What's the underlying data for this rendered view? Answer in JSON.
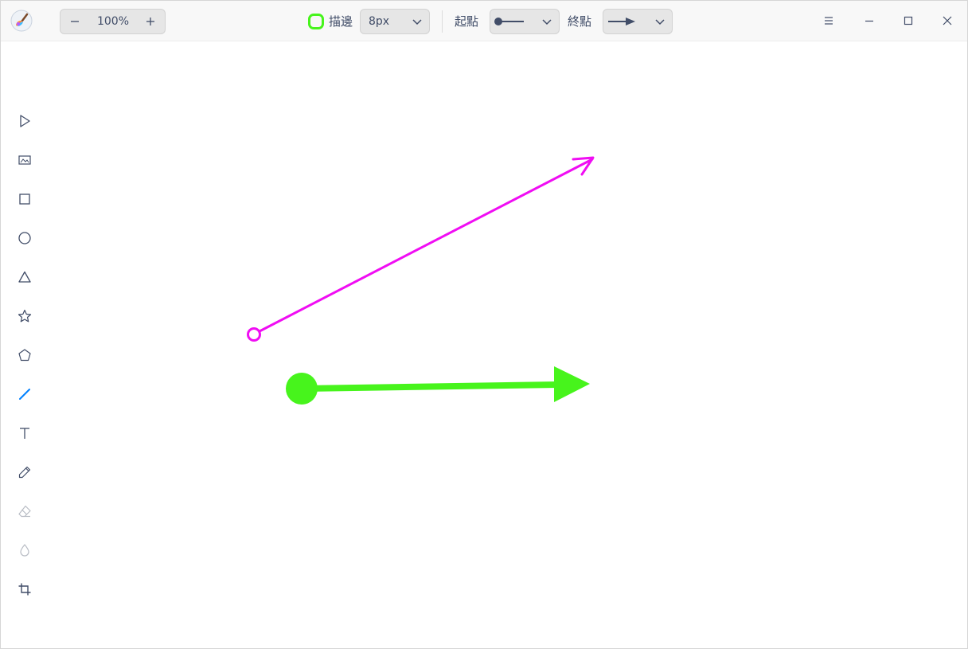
{
  "header": {
    "zoom": {
      "value": "100%"
    },
    "stroke_label": "描邊",
    "stroke_color": "#47f41c",
    "stroke_width": "8px",
    "start_label": "起點",
    "end_label": "終點",
    "start_style": "circle-filled",
    "end_style": "arrow-filled"
  },
  "window_controls": [
    "menu-icon",
    "minimize-icon",
    "maximize-icon",
    "close-icon"
  ],
  "tools": [
    {
      "name": "select",
      "icon": "select-arrow-icon"
    },
    {
      "name": "image",
      "icon": "image-icon"
    },
    {
      "name": "rectangle",
      "icon": "rectangle-icon"
    },
    {
      "name": "ellipse",
      "icon": "ellipse-icon"
    },
    {
      "name": "triangle",
      "icon": "triangle-icon"
    },
    {
      "name": "star",
      "icon": "star-icon"
    },
    {
      "name": "polygon",
      "icon": "polygon-icon"
    },
    {
      "name": "line",
      "icon": "line-icon",
      "active": true
    },
    {
      "name": "text",
      "icon": "text-icon"
    },
    {
      "name": "pencil",
      "icon": "pencil-icon"
    },
    {
      "name": "eraser",
      "icon": "eraser-icon",
      "disabled": true
    },
    {
      "name": "blur",
      "icon": "blur-drop-icon",
      "disabled": true
    },
    {
      "name": "crop",
      "icon": "crop-icon"
    }
  ],
  "canvas": {
    "shapes": [
      {
        "type": "line",
        "color": "#f00df3",
        "start_cap": "circle-hollow",
        "end_cap": "arrow-open"
      },
      {
        "type": "line",
        "color": "#47f41c",
        "start_cap": "circle-filled",
        "end_cap": "arrow-filled"
      }
    ]
  },
  "colors": {
    "icon": "#414d68",
    "accent": "#0081ff",
    "magenta": "#f00df3",
    "green": "#47f41c"
  }
}
